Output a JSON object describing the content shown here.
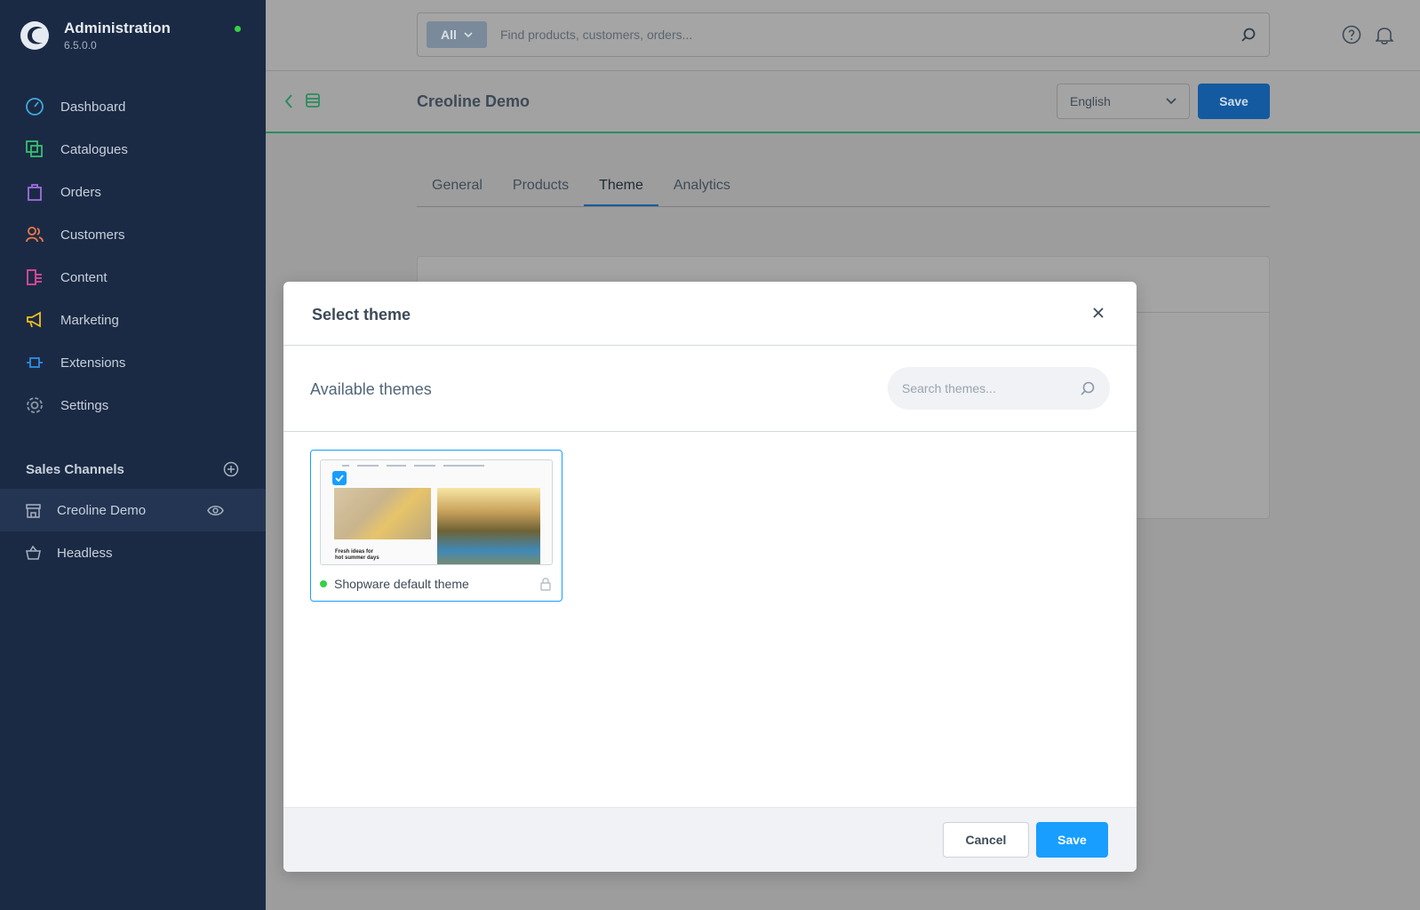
{
  "app": {
    "title": "Administration",
    "version": "6.5.0.0"
  },
  "sidebar": {
    "items": [
      {
        "label": "Dashboard",
        "icon": "dashboard-icon"
      },
      {
        "label": "Catalogues",
        "icon": "catalogues-icon"
      },
      {
        "label": "Orders",
        "icon": "orders-icon"
      },
      {
        "label": "Customers",
        "icon": "customers-icon"
      },
      {
        "label": "Content",
        "icon": "content-icon"
      },
      {
        "label": "Marketing",
        "icon": "marketing-icon"
      },
      {
        "label": "Extensions",
        "icon": "extensions-icon"
      },
      {
        "label": "Settings",
        "icon": "settings-icon"
      }
    ],
    "sales_channels": {
      "title": "Sales Channels",
      "items": [
        {
          "label": "Creoline Demo",
          "icon": "storefront-icon"
        },
        {
          "label": "Headless",
          "icon": "basket-icon"
        }
      ]
    }
  },
  "search": {
    "type": "All",
    "placeholder": "Find products, customers, orders..."
  },
  "header": {
    "title": "Creoline Demo",
    "language": "English",
    "save_label": "Save"
  },
  "tabs": [
    "General",
    "Products",
    "Theme",
    "Analytics"
  ],
  "modal": {
    "title": "Select theme",
    "toolbar_title": "Available themes",
    "search_placeholder": "Search themes...",
    "theme": {
      "name": "Shopware default theme",
      "preview_caption_line1": "Fresh ideas for",
      "preview_caption_line2": "hot summer days"
    },
    "cancel_label": "Cancel",
    "save_label": "Save"
  },
  "colors": {
    "sidebar_bg": "#1b2a44",
    "primary": "#189eff",
    "active_green": "#37d046"
  }
}
